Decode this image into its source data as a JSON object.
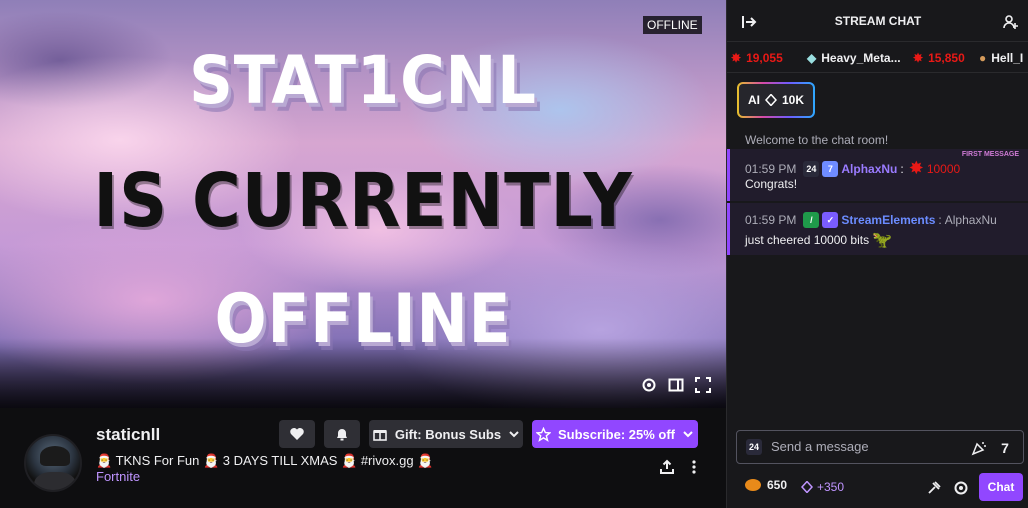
{
  "player": {
    "offline_tag": "OFFLINE",
    "line1": "STAT1CNL",
    "line2": "IS CURRENTLY",
    "line3": "OFFLINE"
  },
  "channel": {
    "name": "staticnll",
    "title": "🎅 TKNS For Fun 🎅 3 DAYS TILL XMAS 🎅 #rivox.gg 🎅",
    "game": "Fortnite"
  },
  "actions": {
    "gift_label": "Gift: Bonus Subs",
    "subscribe_label": "Subscribe: 25% off"
  },
  "chat": {
    "title": "STREAM CHAT",
    "ticker": [
      {
        "amount": "19,055",
        "user": ""
      },
      {
        "amount": "",
        "user": "Heavy_Meta..."
      },
      {
        "amount": "15,850",
        "user": ""
      },
      {
        "amount": "",
        "user": "Hell_I"
      }
    ],
    "ai_badge": {
      "prefix": "AI",
      "value": "10K"
    },
    "welcome": "Welcome to the chat room!",
    "messages": [
      {
        "time": "01:59 PM",
        "user": "AlphaxNu",
        "text": "Congrats!",
        "cheer": "10000",
        "first_label": "FIRST MESSAGE"
      },
      {
        "time": "01:59 PM",
        "user": "StreamElements",
        "text_part1": "AlphaxNu",
        "text_part2": "just cheered 10000 bits"
      }
    ],
    "input_placeholder": "Send a message",
    "points": "650",
    "bonus": "+350",
    "send_label": "Chat"
  },
  "colors": {
    "accent": "#9147ff",
    "background": "#0e0e10",
    "chat_bg": "#18181b",
    "cheer_red": "#e91916",
    "username_purple": "#9a7bff",
    "username_blue": "#6b8cff"
  }
}
